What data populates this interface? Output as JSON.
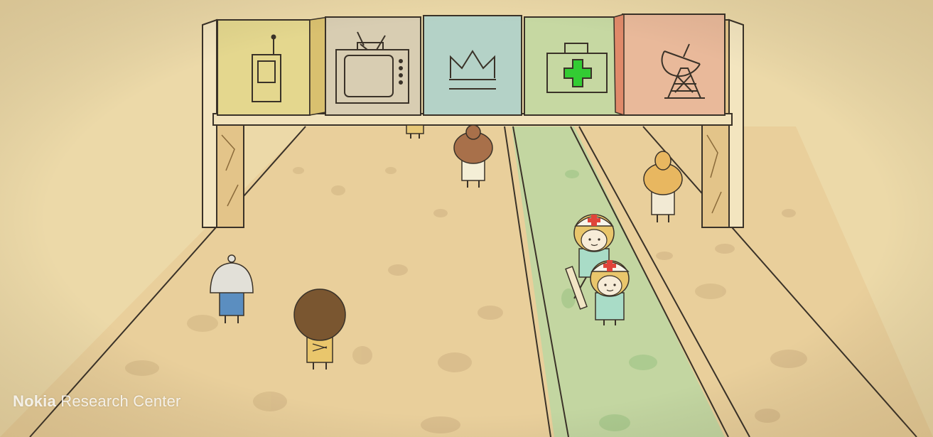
{
  "watermark": {
    "brand": "Nokia",
    "text": "Research Center"
  },
  "signs": [
    {
      "icon": "walkie-talkie-icon",
      "color": "#e4d78e"
    },
    {
      "icon": "television-icon",
      "color": "#d8cdb2"
    },
    {
      "icon": "crown-icon",
      "color": "#b4d2c7"
    },
    {
      "icon": "first-aid-kit-icon",
      "color": "#c6d8a2"
    },
    {
      "icon": "satellite-dish-icon",
      "color": "#e9b99a"
    }
  ],
  "colors": {
    "background": "#ecd9a8",
    "road": "#e8cf9c",
    "highlighted_lane": "#bfd6a2",
    "medical_cross": "#33cc33",
    "nurse_cross": "#e0443a",
    "outline": "#3a3228"
  }
}
